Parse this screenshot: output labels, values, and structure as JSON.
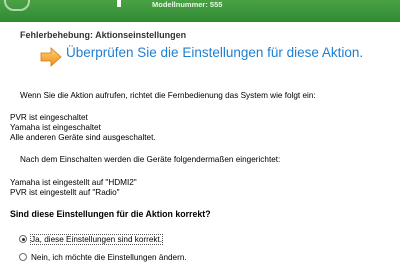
{
  "header": {
    "model_text": "Modellnummer: 555"
  },
  "breadcrumb": "Fehlerbehebung:  Aktionseinstellungen",
  "title": "Überprüfen Sie die Einstellungen für diese Aktion.",
  "intro": "Wenn Sie die Aktion aufrufen, richtet die Fernbedienung das System wie folgt ein:",
  "power_states": [
    "PVR ist eingeschaltet",
    "Yamaha ist eingeschaltet",
    "Alle anderen Geräte sind ausgeschaltet."
  ],
  "after_on_text": "Nach dem Einschalten werden die Geräte folgendermaßen eingerichtet:",
  "input_states": [
    "Yamaha ist eingestellt auf \"HDMI2\"",
    "PVR ist eingestellt auf \"Radio\""
  ],
  "question": "Sind diese Einstellungen für die Aktion korrekt?",
  "options": [
    {
      "label": "Ja, diese Einstellungen sind korrekt.",
      "checked": true
    },
    {
      "label": "Nein, ich möchte die Einstellungen ändern.",
      "checked": false
    }
  ],
  "colors": {
    "header_green": "#3a9a3c",
    "title_blue": "#1f7fd0",
    "arrow_orange": "#f4a62a"
  },
  "icons": {
    "header_left": "logo-ring-icon",
    "title": "arrow-right-icon"
  }
}
